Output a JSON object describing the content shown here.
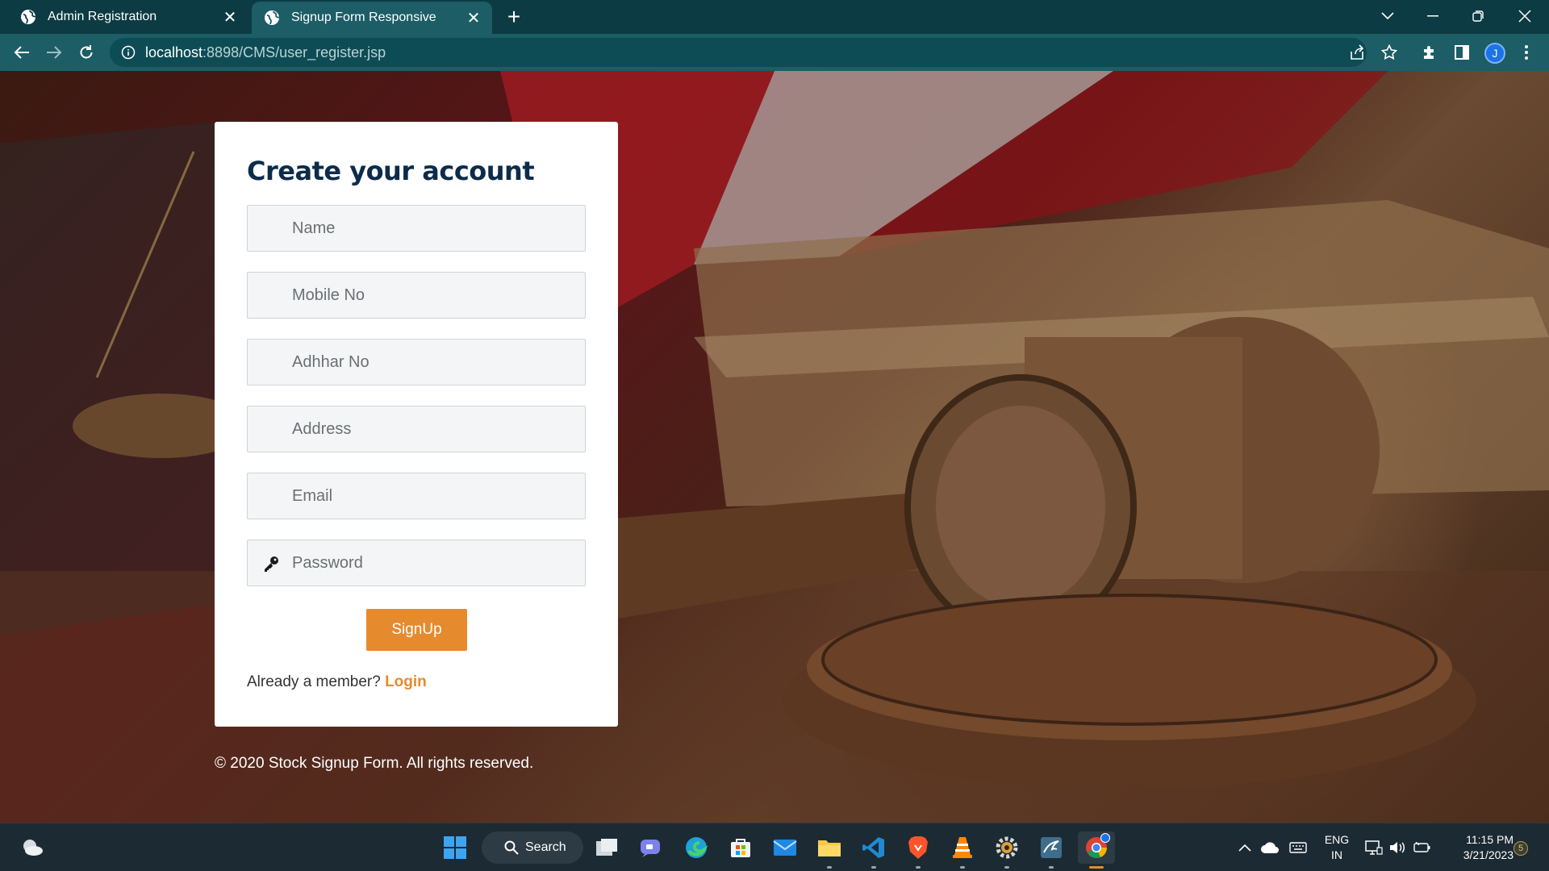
{
  "browser": {
    "tabs": [
      {
        "title": "Admin Registration",
        "active": false
      },
      {
        "title": "Signup Form Responsive",
        "active": true
      }
    ],
    "url_host": "localhost",
    "url_rest": ":8898/CMS/user_register.jsp",
    "profile_initial": "J"
  },
  "form": {
    "title": "Create your account",
    "fields": [
      {
        "placeholder": "Name"
      },
      {
        "placeholder": "Mobile No"
      },
      {
        "placeholder": "Adhhar No"
      },
      {
        "placeholder": "Address"
      },
      {
        "placeholder": "Email"
      },
      {
        "placeholder": "Password",
        "icon": "key-icon"
      }
    ],
    "submit_label": "SignUp",
    "member_text": "Already a member?",
    "login_label": "Login",
    "accent_color": "#e68a2e",
    "title_color": "#0d2c4a"
  },
  "footer": {
    "copyright": "© 2020 Stock Signup Form. All rights reserved."
  },
  "taskbar": {
    "search_label": "Search",
    "lang_top": "ENG",
    "lang_bottom": "IN",
    "time": "11:15 PM",
    "date": "3/21/2023",
    "notification_count": "5"
  }
}
